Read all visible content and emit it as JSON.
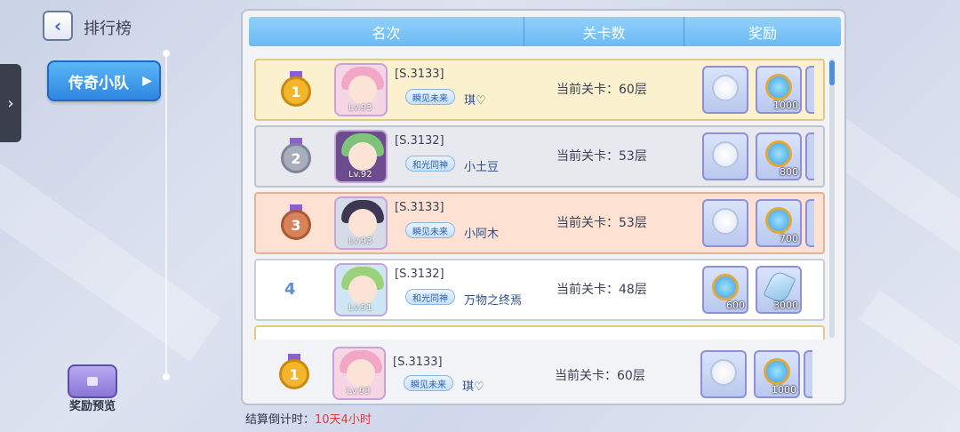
{
  "nav": {
    "title": "排行榜",
    "back_icon": "chevron-left-icon",
    "drawer_icon": "chevron-right-icon",
    "team_button": "传奇小队",
    "reward_preview": "奖励预览"
  },
  "table": {
    "headers": {
      "rank": "名次",
      "stage": "关卡数",
      "reward": "奖励"
    },
    "rows": [
      {
        "rank": "1",
        "medal": "gold",
        "server": "[S.3133]",
        "guild": "瞬见未来",
        "name": "琪♡",
        "level": "Lv.93",
        "stage": "当前关卡：60层",
        "rewards": [
          {
            "icon": "orb-icon",
            "qty": ""
          },
          {
            "icon": "coin-icon",
            "qty": "1000"
          }
        ]
      },
      {
        "rank": "2",
        "medal": "silver",
        "server": "[S.3132]",
        "guild": "和光同神",
        "name": "小土豆",
        "level": "Lv.92",
        "stage": "当前关卡：53层",
        "rewards": [
          {
            "icon": "orb-icon",
            "qty": ""
          },
          {
            "icon": "coin-icon",
            "qty": "800"
          }
        ]
      },
      {
        "rank": "3",
        "medal": "bronze",
        "server": "[S.3133]",
        "guild": "瞬见未来",
        "name": "小阿木",
        "level": "Lv.93",
        "stage": "当前关卡：53层",
        "rewards": [
          {
            "icon": "orb-icon",
            "qty": ""
          },
          {
            "icon": "coin-icon",
            "qty": "700"
          }
        ]
      },
      {
        "rank": "4",
        "medal": "none",
        "server": "[S.3132]",
        "guild": "和光同神",
        "name": "万物之终焉",
        "level": "Lv.91",
        "stage": "当前关卡：48层",
        "rewards": [
          {
            "icon": "coin-icon",
            "qty": "600"
          },
          {
            "icon": "gem-icon",
            "qty": "3000"
          }
        ]
      }
    ],
    "my_row": {
      "rank": "1",
      "medal": "gold",
      "server": "[S.3133]",
      "guild": "瞬见未来",
      "name": "琪♡",
      "level": "Lv.93",
      "stage": "当前关卡：60层",
      "rewards": [
        {
          "icon": "orb-icon",
          "qty": ""
        },
        {
          "icon": "coin-icon",
          "qty": "1000"
        }
      ]
    }
  },
  "countdown": {
    "label": "结算倒计时：",
    "value": "10天4小时"
  },
  "colors": {
    "gold": "#f3b52a",
    "silver": "#a8aebb",
    "bronze": "#d9825a",
    "accent": "#3a8fe6",
    "countdown": "#e23b3b"
  }
}
